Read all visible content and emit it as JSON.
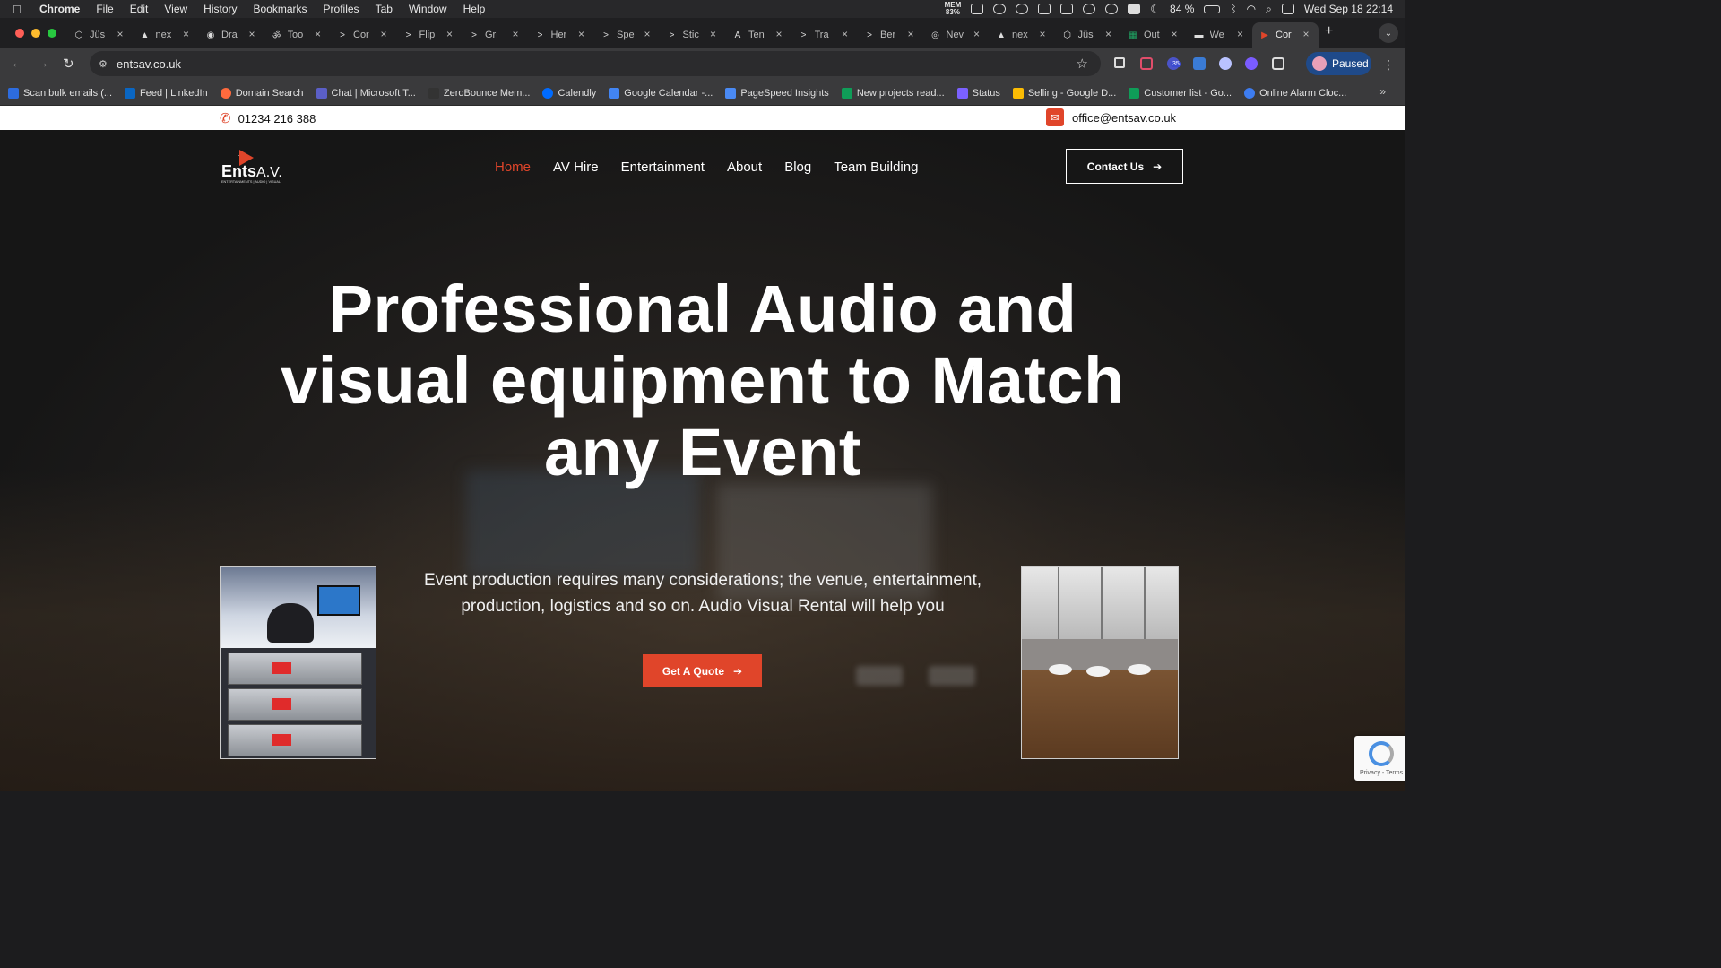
{
  "menubar": {
    "app": "Chrome",
    "items": [
      "File",
      "Edit",
      "View",
      "History",
      "Bookmarks",
      "Profiles",
      "Tab",
      "Window",
      "Help"
    ],
    "mem_label": "MEM",
    "mem_value": "83%",
    "battery": "84 %",
    "datetime": "Wed Sep 18  22:14"
  },
  "tabs": [
    {
      "fav": "⬡",
      "title": "Jüs"
    },
    {
      "fav": "▲",
      "title": "nex"
    },
    {
      "fav": "◉",
      "title": "Dra"
    },
    {
      "fav": "ॐ",
      "title": "Too"
    },
    {
      "fav": ">",
      "title": "Cor"
    },
    {
      "fav": ">",
      "title": "Flip"
    },
    {
      "fav": ">",
      "title": "Gri"
    },
    {
      "fav": ">",
      "title": "Her"
    },
    {
      "fav": ">",
      "title": "Spe"
    },
    {
      "fav": ">",
      "title": "Stic"
    },
    {
      "fav": "A",
      "title": "Ten"
    },
    {
      "fav": ">",
      "title": "Tra"
    },
    {
      "fav": ">",
      "title": "Ber"
    },
    {
      "fav": "◎",
      "title": "Nev"
    },
    {
      "fav": "▲",
      "title": "nex"
    },
    {
      "fav": "⬡",
      "title": "Jüs"
    },
    {
      "fav": "▦",
      "title": "Out"
    },
    {
      "fav": "▬",
      "title": "We"
    },
    {
      "fav": "▶",
      "title": "Cor"
    }
  ],
  "toolbar": {
    "url": "entsav.co.uk",
    "profile_label": "Paused",
    "ext_badge": "35"
  },
  "bookmarks": [
    {
      "label": "Scan bulk emails (...",
      "color": "#2d6cdf"
    },
    {
      "label": "Feed | LinkedIn",
      "color": "#0a66c2"
    },
    {
      "label": "Domain Search",
      "color": "#ff6a3d"
    },
    {
      "label": "Chat | Microsoft T...",
      "color": "#5b5fc7"
    },
    {
      "label": "ZeroBounce Mem...",
      "color": "#333333"
    },
    {
      "label": "Calendly",
      "color": "#006bff"
    },
    {
      "label": "Google Calendar -...",
      "color": "#4285f4"
    },
    {
      "label": "PageSpeed Insights",
      "color": "#4a8af4"
    },
    {
      "label": "New projects read...",
      "color": "#0f9d58"
    },
    {
      "label": "Status",
      "color": "#7b61ff"
    },
    {
      "label": "Selling - Google D...",
      "color": "#fbbc04"
    },
    {
      "label": "Customer list - Go...",
      "color": "#0f9d58"
    },
    {
      "label": "Online Alarm Cloc...",
      "color": "#3d7cf0"
    }
  ],
  "site": {
    "phone": "01234 216 388",
    "email": "office@entsav.co.uk",
    "logo_word": "Ents",
    "logo_av": "A.V.",
    "logo_tag": "ENTERTAINMENTS | AUDIO | VISUAL",
    "nav": [
      "Home",
      "AV Hire",
      "Entertainment",
      "About",
      "Blog",
      "Team Building"
    ],
    "contact_label": "Contact Us",
    "headline": "Professional Audio and visual equipment to Match any Event",
    "subtext": "Event production requires many considerations; the venue, entertainment, production, logistics and so on. Audio Visual Rental will help you",
    "quote_label": "Get A Quote",
    "recaptcha_text": "Privacy - Terms",
    "accent_color": "#e0452a"
  }
}
